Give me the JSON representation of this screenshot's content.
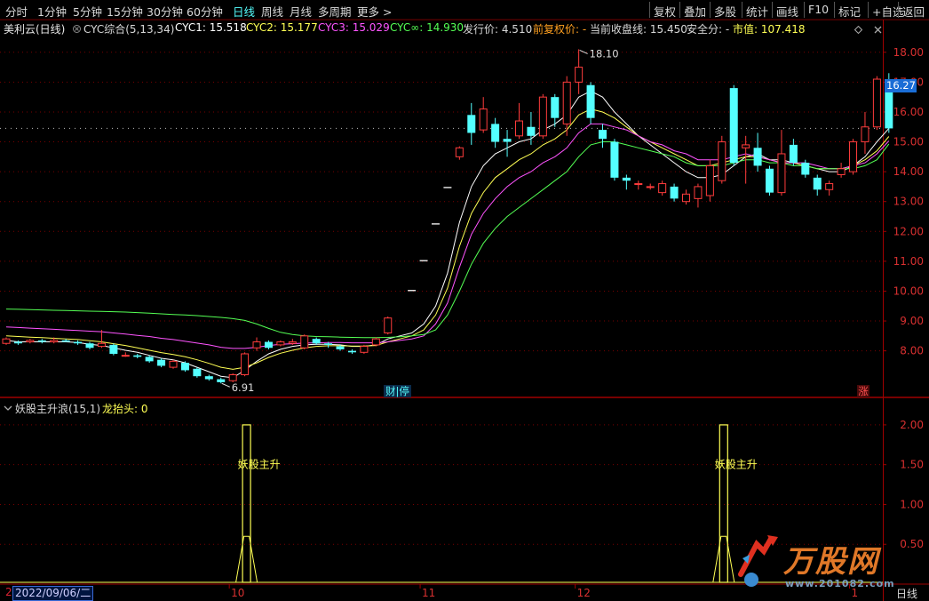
{
  "toolbar": {
    "left_items": [
      "分时",
      "1分钟",
      "5分钟",
      "15分钟",
      "30分钟",
      "60分钟",
      "日线",
      "周线",
      "月线",
      "多周期",
      "更多 >"
    ],
    "active_item": "日线",
    "right_items": [
      "复权",
      "叠加",
      "多股",
      "统计",
      "画线",
      "F10",
      "标记",
      "+自选",
      "返回"
    ]
  },
  "infobar": {
    "stock": "美利云(日线)",
    "indicator": "CYC综合(5,13,34)",
    "cyc1": "CYC1: 15.518",
    "cyc2": "CYC2: 15.177",
    "cyc3": "CYC3: 15.029",
    "cycinf": "CYC∞: 14.930",
    "issue_price": "发行价: 4.510",
    "pre_adj": "前复权价: -",
    "cur_close_line": "当前收盘线: 15.450",
    "safety": "安全分: -",
    "mkt_value": "市值: 107.418"
  },
  "price_axis": [
    "18.00",
    "17.00",
    "16.00",
    "15.00",
    "14.00",
    "13.00",
    "12.00",
    "11.00",
    "10.00",
    "9.00",
    "8.00"
  ],
  "current_price_tag": "16.27",
  "high_label": "18.10",
  "low_label": "6.91",
  "event_labels": {
    "finance": "财|停",
    "limit_up": "涨"
  },
  "indicator_bar": {
    "name": "妖股主升浪(15,1)",
    "field": "龙抬头: 0"
  },
  "indicator_axis": [
    "2.00",
    "1.50",
    "1.00",
    "0.50"
  ],
  "signal_label": "妖股主升",
  "date_axis": {
    "start_marker": "2",
    "cursor_date": "2022/09/06/二",
    "months": [
      "10",
      "11",
      "12",
      "1"
    ],
    "period": "日线"
  },
  "watermark": {
    "brand": "万股网",
    "url": "www.201082.com"
  },
  "colors": {
    "up": "#ff3c3c",
    "down": "#54ffff",
    "cyc1": "#ffffff",
    "cyc2": "#ffff54",
    "cyc3": "#ff54ff",
    "cycinf": "#54ff54",
    "grid": "#7a0000",
    "axis_text": "#d83030"
  },
  "chart_data": {
    "type": "candlestick",
    "ylim": [
      6.5,
      18.5
    ],
    "candles": [
      {
        "o": 8.25,
        "c": 8.4,
        "h": 8.45,
        "l": 8.2
      },
      {
        "o": 8.3,
        "c": 8.25,
        "h": 8.35,
        "l": 8.2
      },
      {
        "o": 8.3,
        "c": 8.35,
        "h": 8.4,
        "l": 8.25
      },
      {
        "o": 8.35,
        "c": 8.3,
        "h": 8.4,
        "l": 8.25
      },
      {
        "o": 8.3,
        "c": 8.35,
        "h": 8.45,
        "l": 8.25
      },
      {
        "o": 8.35,
        "c": 8.3,
        "h": 8.4,
        "l": 8.3
      },
      {
        "o": 8.3,
        "c": 8.25,
        "h": 8.35,
        "l": 8.2
      },
      {
        "o": 8.25,
        "c": 8.1,
        "h": 8.3,
        "l": 8.05
      },
      {
        "o": 8.15,
        "c": 8.25,
        "h": 8.7,
        "l": 8.1
      },
      {
        "o": 8.2,
        "c": 7.9,
        "h": 8.25,
        "l": 7.85
      },
      {
        "o": 7.85,
        "c": 7.85,
        "h": 7.95,
        "l": 7.8
      },
      {
        "o": 7.85,
        "c": 7.8,
        "h": 7.9,
        "l": 7.75
      },
      {
        "o": 7.8,
        "c": 7.65,
        "h": 7.85,
        "l": 7.6
      },
      {
        "o": 7.7,
        "c": 7.5,
        "h": 7.75,
        "l": 7.45
      },
      {
        "o": 7.45,
        "c": 7.65,
        "h": 7.7,
        "l": 7.4
      },
      {
        "o": 7.6,
        "c": 7.35,
        "h": 7.65,
        "l": 7.3
      },
      {
        "o": 7.4,
        "c": 7.15,
        "h": 7.45,
        "l": 7.1
      },
      {
        "o": 7.15,
        "c": 7.05,
        "h": 7.2,
        "l": 7.0
      },
      {
        "o": 7.05,
        "c": 6.95,
        "h": 7.1,
        "l": 6.91
      },
      {
        "o": 7.0,
        "c": 7.2,
        "h": 7.25,
        "l": 6.95
      },
      {
        "o": 7.2,
        "c": 7.9,
        "h": 7.95,
        "l": 7.15
      },
      {
        "o": 8.1,
        "c": 8.3,
        "h": 8.45,
        "l": 8.0
      },
      {
        "o": 8.3,
        "c": 8.1,
        "h": 8.35,
        "l": 8.05
      },
      {
        "o": 8.2,
        "c": 8.3,
        "h": 8.35,
        "l": 8.15
      },
      {
        "o": 8.25,
        "c": 8.3,
        "h": 8.4,
        "l": 8.2
      },
      {
        "o": 8.1,
        "c": 8.5,
        "h": 8.55,
        "l": 8.05
      },
      {
        "o": 8.4,
        "c": 8.25,
        "h": 8.45,
        "l": 8.2
      },
      {
        "o": 8.25,
        "c": 8.2,
        "h": 8.3,
        "l": 8.1
      },
      {
        "o": 8.15,
        "c": 8.05,
        "h": 8.2,
        "l": 8.0
      },
      {
        "o": 8.0,
        "c": 7.95,
        "h": 8.05,
        "l": 7.9
      },
      {
        "o": 7.95,
        "c": 8.15,
        "h": 8.2,
        "l": 7.9
      },
      {
        "o": 8.2,
        "c": 8.4,
        "h": 8.45,
        "l": 8.15
      },
      {
        "o": 8.6,
        "c": 9.1,
        "h": 9.15,
        "l": 8.55
      },
      {
        "o": null,
        "c": null
      },
      {
        "o": 10.02,
        "c": 10.02,
        "h": 10.02,
        "l": 10.02,
        "flat": true
      },
      {
        "o": 11.02,
        "c": 11.02,
        "h": 11.02,
        "l": 11.02,
        "flat": true
      },
      {
        "o": 12.25,
        "c": 12.25,
        "h": 12.25,
        "l": 12.25,
        "flat": true
      },
      {
        "o": 13.47,
        "c": 13.47,
        "h": 13.47,
        "l": 13.47,
        "flat": true
      },
      {
        "o": 14.5,
        "c": 14.8,
        "h": 14.85,
        "l": 14.4
      },
      {
        "o": 15.9,
        "c": 15.3,
        "h": 16.3,
        "l": 14.9
      },
      {
        "o": 15.4,
        "c": 16.1,
        "h": 16.5,
        "l": 15.3
      },
      {
        "o": 15.6,
        "c": 15.0,
        "h": 15.8,
        "l": 14.8
      },
      {
        "o": 15.1,
        "c": 15.0,
        "h": 15.4,
        "l": 14.5
      },
      {
        "o": 15.2,
        "c": 15.7,
        "h": 16.3,
        "l": 15.1
      },
      {
        "o": 15.5,
        "c": 15.2,
        "h": 16.0,
        "l": 14.9
      },
      {
        "o": 15.2,
        "c": 16.5,
        "h": 16.6,
        "l": 15.1
      },
      {
        "o": 16.5,
        "c": 15.8,
        "h": 16.6,
        "l": 15.5
      },
      {
        "o": 15.6,
        "c": 17.0,
        "h": 17.2,
        "l": 15.2
      },
      {
        "o": 17.0,
        "c": 17.5,
        "h": 18.1,
        "l": 16.6
      },
      {
        "o": 16.9,
        "c": 15.8,
        "h": 17.0,
        "l": 15.6
      },
      {
        "o": 15.4,
        "c": 15.1,
        "h": 15.6,
        "l": 14.8
      },
      {
        "o": 15.0,
        "c": 13.8,
        "h": 15.1,
        "l": 13.7
      },
      {
        "o": 13.8,
        "c": 13.7,
        "h": 13.9,
        "l": 13.4
      },
      {
        "o": 13.6,
        "c": 13.6,
        "h": 13.7,
        "l": 13.4
      },
      {
        "o": 13.5,
        "c": 13.5,
        "h": 13.6,
        "l": 13.4
      },
      {
        "o": 13.3,
        "c": 13.6,
        "h": 13.7,
        "l": 13.2
      },
      {
        "o": 13.5,
        "c": 13.1,
        "h": 13.6,
        "l": 13.0
      },
      {
        "o": 13.0,
        "c": 13.25,
        "h": 13.4,
        "l": 12.9
      },
      {
        "o": 13.1,
        "c": 13.5,
        "h": 13.6,
        "l": 12.8
      },
      {
        "o": 13.2,
        "c": 14.2,
        "h": 14.4,
        "l": 13.0
      },
      {
        "o": 13.7,
        "c": 15.0,
        "h": 15.2,
        "l": 13.6
      },
      {
        "o": 16.8,
        "c": 14.3,
        "h": 16.9,
        "l": 14.2
      },
      {
        "o": 14.8,
        "c": 14.9,
        "h": 15.2,
        "l": 13.6
      },
      {
        "o": 14.8,
        "c": 14.2,
        "h": 15.3,
        "l": 14.0
      },
      {
        "o": 14.1,
        "c": 13.3,
        "h": 14.2,
        "l": 13.2
      },
      {
        "o": 13.3,
        "c": 14.6,
        "h": 15.4,
        "l": 13.2
      },
      {
        "o": 14.9,
        "c": 14.3,
        "h": 15.1,
        "l": 14.2
      },
      {
        "o": 14.3,
        "c": 13.9,
        "h": 14.4,
        "l": 13.8
      },
      {
        "o": 13.8,
        "c": 13.4,
        "h": 13.9,
        "l": 13.2
      },
      {
        "o": 13.4,
        "c": 13.6,
        "h": 13.7,
        "l": 13.2
      },
      {
        "o": 13.9,
        "c": 14.1,
        "h": 14.3,
        "l": 13.8
      },
      {
        "o": 14.0,
        "c": 15.0,
        "h": 15.1,
        "l": 13.9
      },
      {
        "o": 15.0,
        "c": 15.5,
        "h": 16.0,
        "l": 14.6
      },
      {
        "o": 15.5,
        "c": 17.1,
        "h": 17.2,
        "l": 15.4
      },
      {
        "o": 17.0,
        "c": 15.45,
        "h": 17.3,
        "l": 15.3
      }
    ],
    "series": [
      {
        "name": "CYC1",
        "values": [
          8.35,
          8.3,
          8.3,
          8.3,
          8.3,
          8.3,
          8.28,
          8.22,
          8.18,
          8.1,
          8.02,
          7.95,
          7.85,
          7.75,
          7.7,
          7.6,
          7.45,
          7.3,
          7.15,
          7.1,
          7.35,
          7.65,
          7.9,
          8.05,
          8.15,
          8.2,
          8.22,
          8.22,
          8.2,
          8.15,
          8.15,
          8.2,
          8.4,
          8.5,
          8.6,
          8.9,
          9.5,
          10.6,
          12.3,
          13.5,
          14.2,
          14.6,
          14.8,
          15.0,
          15.1,
          15.4,
          15.6,
          15.9,
          16.5,
          16.7,
          16.5,
          16.0,
          15.6,
          15.2,
          14.9,
          14.6,
          14.3,
          14.0,
          13.8,
          13.8,
          13.9,
          14.2,
          14.5,
          14.6,
          14.4,
          14.4,
          14.3,
          14.2,
          14.1,
          14.0,
          14.0,
          14.2,
          14.5,
          15.0,
          15.45
        ]
      },
      {
        "name": "CYC2",
        "values": [
          8.5,
          8.48,
          8.46,
          8.44,
          8.42,
          8.4,
          8.38,
          8.34,
          8.3,
          8.24,
          8.18,
          8.1,
          8.02,
          7.94,
          7.88,
          7.8,
          7.7,
          7.58,
          7.45,
          7.38,
          7.45,
          7.6,
          7.78,
          7.92,
          8.02,
          8.1,
          8.15,
          8.17,
          8.17,
          8.16,
          8.16,
          8.18,
          8.3,
          8.4,
          8.5,
          8.7,
          9.2,
          10.1,
          11.5,
          12.6,
          13.3,
          13.8,
          14.1,
          14.4,
          14.6,
          14.9,
          15.1,
          15.4,
          15.9,
          16.1,
          16.0,
          15.8,
          15.5,
          15.2,
          15.0,
          14.8,
          14.6,
          14.4,
          14.2,
          14.2,
          14.3,
          14.4,
          14.5,
          14.5,
          14.4,
          14.3,
          14.3,
          14.2,
          14.1,
          14.1,
          14.1,
          14.2,
          14.4,
          14.7,
          15.18
        ]
      },
      {
        "name": "CYC3",
        "values": [
          8.8,
          8.78,
          8.76,
          8.74,
          8.72,
          8.7,
          8.68,
          8.66,
          8.64,
          8.6,
          8.56,
          8.52,
          8.48,
          8.42,
          8.38,
          8.32,
          8.26,
          8.2,
          8.12,
          8.08,
          8.08,
          8.12,
          8.18,
          8.22,
          8.24,
          8.26,
          8.27,
          8.28,
          8.28,
          8.27,
          8.27,
          8.27,
          8.3,
          8.35,
          8.4,
          8.5,
          8.9,
          9.6,
          10.8,
          11.9,
          12.6,
          13.1,
          13.5,
          13.8,
          14.0,
          14.3,
          14.5,
          14.8,
          15.3,
          15.6,
          15.6,
          15.5,
          15.4,
          15.2,
          15.0,
          14.9,
          14.7,
          14.6,
          14.4,
          14.4,
          14.4,
          14.5,
          14.6,
          14.5,
          14.4,
          14.3,
          14.3,
          14.3,
          14.2,
          14.1,
          14.1,
          14.2,
          14.3,
          14.6,
          15.03
        ]
      },
      {
        "name": "CYC∞",
        "values": [
          9.4,
          9.39,
          9.38,
          9.37,
          9.36,
          9.35,
          9.34,
          9.33,
          9.32,
          9.31,
          9.3,
          9.28,
          9.26,
          9.24,
          9.22,
          9.2,
          9.18,
          9.15,
          9.12,
          9.08,
          9.02,
          8.9,
          8.75,
          8.62,
          8.55,
          8.5,
          8.48,
          8.47,
          8.46,
          8.45,
          8.44,
          8.44,
          8.45,
          8.47,
          8.5,
          8.55,
          8.7,
          9.2,
          10.0,
          10.9,
          11.6,
          12.1,
          12.5,
          12.8,
          13.1,
          13.4,
          13.7,
          14.0,
          14.5,
          14.9,
          15.0,
          15.0,
          14.9,
          14.8,
          14.7,
          14.6,
          14.5,
          14.3,
          14.2,
          14.2,
          14.2,
          14.3,
          14.4,
          14.4,
          14.3,
          14.3,
          14.2,
          14.2,
          14.1,
          14.1,
          14.1,
          14.1,
          14.2,
          14.4,
          14.93
        ]
      }
    ],
    "indicator_spikes": [
      {
        "x_index": 20,
        "value": 2.0
      },
      {
        "x_index": 60,
        "value": 2.0
      }
    ],
    "indicator_ylim": [
      0,
      2.2
    ]
  }
}
